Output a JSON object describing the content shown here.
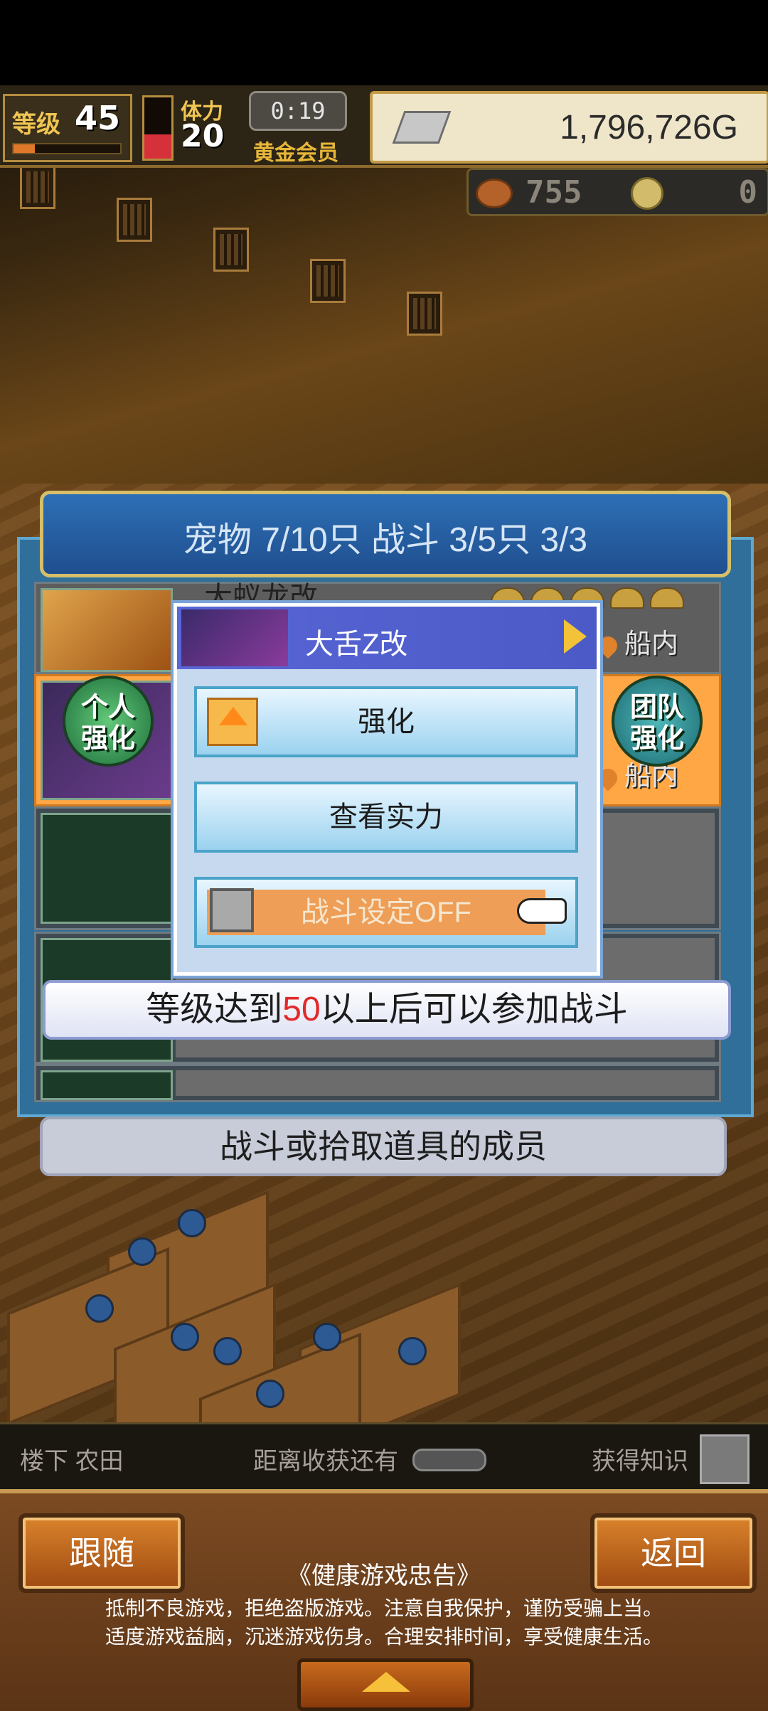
{
  "hud": {
    "level_label": "等级",
    "level": "45",
    "level_progress": 0.2,
    "stamina_label": "体力",
    "stamina": "20",
    "stamina_fill": 0.4,
    "timer": "0:19",
    "member_label": "黄金会员",
    "gold": "1,796,726G",
    "meat_count": "755",
    "coin_count": "0"
  },
  "pet_panel": {
    "header": "宠物 7/10只 战斗 3/5只  3/3",
    "row1_name": "大蚁龙改",
    "location_1": "船内",
    "location_2": "船内",
    "personal_boost": "个人强化",
    "team_boost": "团队强化"
  },
  "popup": {
    "title": "大舌Z改",
    "strengthen": "强化",
    "view_strength": "查看实力",
    "battle_setting": "战斗设定OFF"
  },
  "notice": {
    "prefix": "等级达到",
    "number": "50",
    "suffix": "以上后可以参加战斗"
  },
  "members_label": "战斗或拾取道具的成员",
  "status_bar": {
    "location": "楼下 农田",
    "harvest": "距离收获还有",
    "knowledge": "获得知识"
  },
  "bottom_bar": {
    "follow": "跟随",
    "back": "返回",
    "health_title": "《健康游戏忠告》",
    "health_line_1": "抵制不良游戏，拒绝盗版游戏。注意自我保护，谨防受骗上当。",
    "health_line_2": "适度游戏益脑，沉迷游戏伤身。合理安排时间，享受健康生活。"
  },
  "colors": {
    "accent_blue": "#2d6fb5",
    "highlight_orange": "#ffa645",
    "warning_red": "#e12a2a"
  }
}
